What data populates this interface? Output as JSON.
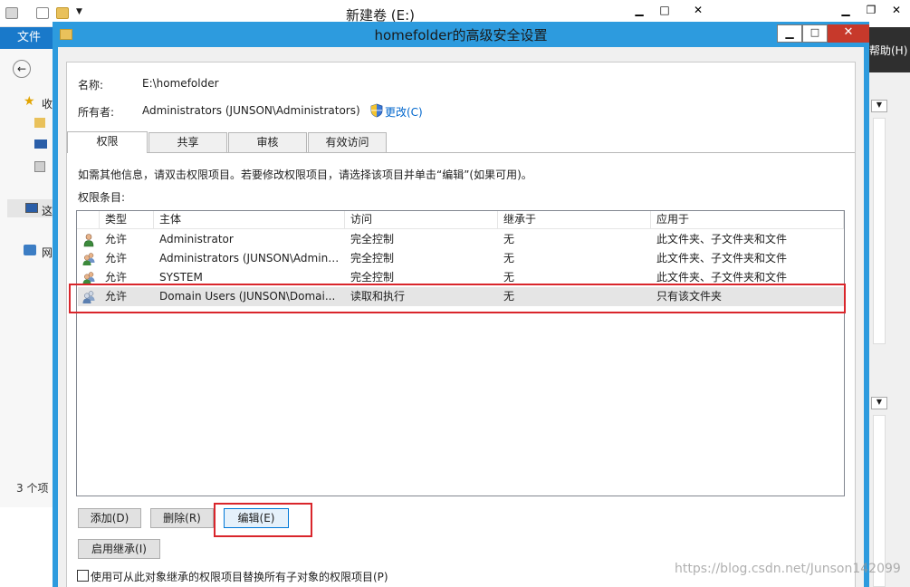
{
  "explorer": {
    "title": "新建卷 (E:)",
    "ribbon_file": "文件",
    "status_items": "3 个项",
    "nav": [
      {
        "label": "收",
        "icon": "star-icon"
      },
      {
        "label": "这",
        "icon": "computer-icon"
      },
      {
        "label": "网",
        "icon": "network-icon"
      }
    ],
    "right_help": "帮助(H)"
  },
  "dialog": {
    "title": "homefolder的高级安全设置",
    "name_label": "名称:",
    "name_value": "E:\\homefolder",
    "owner_label": "所有者:",
    "owner_value": "Administrators (JUNSON\\Administrators)",
    "change_link": "更改(C)",
    "tabs": [
      "权限",
      "共享",
      "审核",
      "有效访问"
    ],
    "info_text": "如需其他信息，请双击权限项目。若要修改权限项目，请选择该项目并单击“编辑”(如果可用)。",
    "entries_label": "权限条目:",
    "columns": [
      "类型",
      "主体",
      "访问",
      "继承于",
      "应用于"
    ],
    "rows": [
      {
        "type": "允许",
        "principal": "Administrator",
        "access": "完全控制",
        "inherited": "无",
        "applies": "此文件夹、子文件夹和文件",
        "icon": "user-icon"
      },
      {
        "type": "允许",
        "principal": "Administrators (JUNSON\\Admini...",
        "access": "完全控制",
        "inherited": "无",
        "applies": "此文件夹、子文件夹和文件",
        "icon": "group-icon"
      },
      {
        "type": "允许",
        "principal": "SYSTEM",
        "access": "完全控制",
        "inherited": "无",
        "applies": "此文件夹、子文件夹和文件",
        "icon": "group-icon"
      },
      {
        "type": "允许",
        "principal": "Domain Users (JUNSON\\Domai...",
        "access": "读取和执行",
        "inherited": "无",
        "applies": "只有该文件夹",
        "icon": "group-icon"
      }
    ],
    "buttons": {
      "add": "添加(D)",
      "remove": "删除(R)",
      "edit": "编辑(E)",
      "enable_inheritance": "启用继承(I)"
    },
    "replace_checkbox_label": "使用可从此对象继承的权限项目替换所有子对象的权限项目(P)",
    "selected_row": 3
  },
  "watermark": "https://blog.csdn.net/Junson142099",
  "colors": {
    "accent": "#2d9bde",
    "highlight": "#d9252b",
    "link": "#0066cc"
  }
}
